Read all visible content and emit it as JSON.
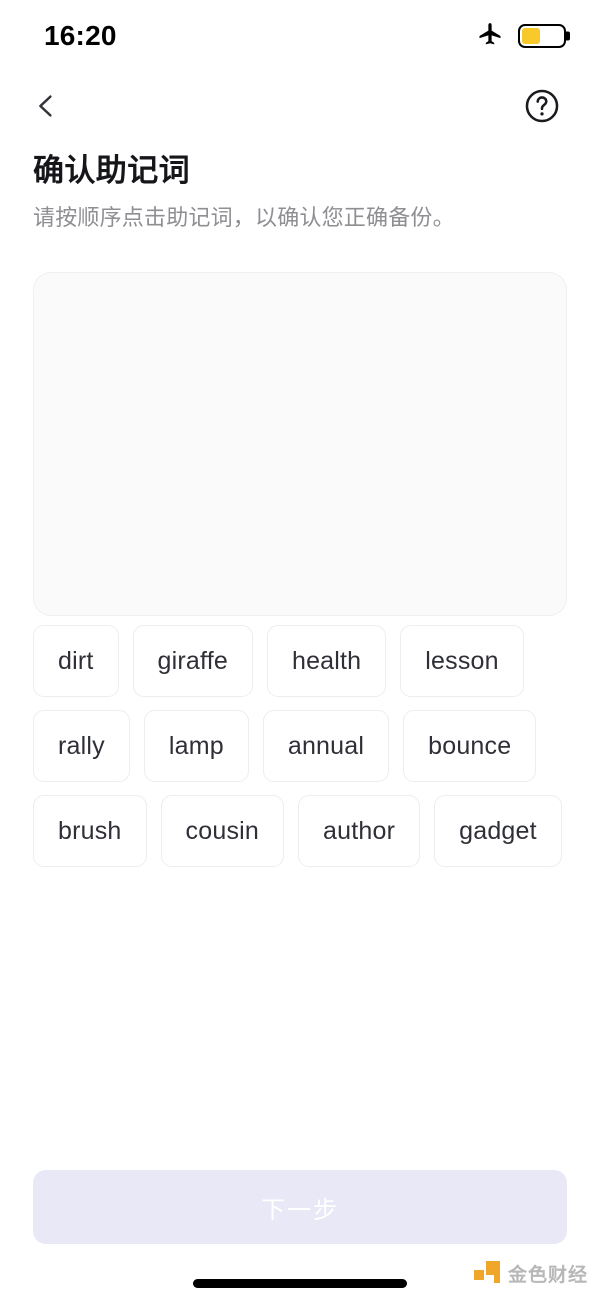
{
  "status_bar": {
    "time": "16:20",
    "airplane_icon": "airplane-mode-icon",
    "battery_icon": "battery-low-power-icon",
    "battery_level_percent": 46,
    "battery_color": "#f7c92b"
  },
  "nav": {
    "back_icon": "chevron-left-icon",
    "help_icon": "question-mark-circle-icon"
  },
  "header": {
    "title": "确认助记词",
    "subtitle": "请按顺序点击助记词，以确认您正确备份。"
  },
  "answer_panel": {
    "selected_words": [],
    "background_color": "#fafafa"
  },
  "word_pool": {
    "words": [
      "dirt",
      "giraffe",
      "health",
      "lesson",
      "rally",
      "lamp",
      "annual",
      "bounce",
      "brush",
      "cousin",
      "author",
      "gadget"
    ]
  },
  "footer": {
    "next_button_label": "下一步",
    "next_button_enabled": false,
    "next_button_color": "#e8e8f6"
  },
  "watermark": {
    "text": "金色财经",
    "logo_color": "#f0a31e"
  }
}
